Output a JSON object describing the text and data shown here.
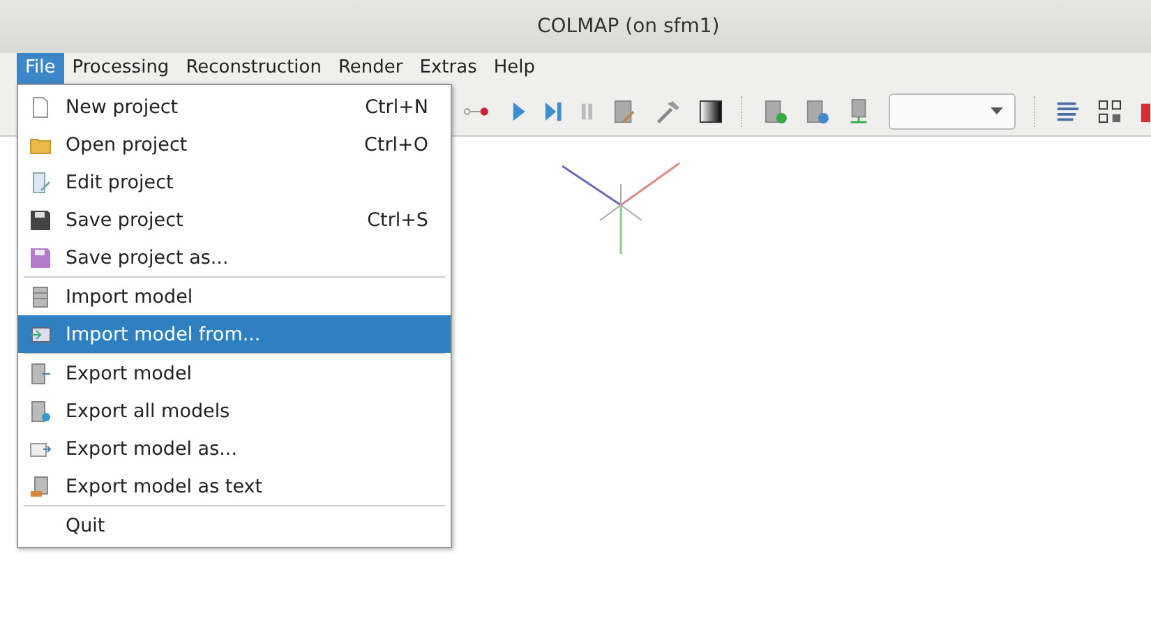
{
  "window": {
    "title": "COLMAP (on sfm1)"
  },
  "menu_bar": [
    {
      "label": "File",
      "selected": true
    },
    {
      "label": "Processing",
      "selected": false
    },
    {
      "label": "Reconstruction",
      "selected": false
    },
    {
      "label": "Render",
      "selected": false
    },
    {
      "label": "Extras",
      "selected": false
    },
    {
      "label": "Help",
      "selected": false
    }
  ],
  "file_menu": [
    {
      "kind": "item",
      "label": "New project",
      "shortcut": "Ctrl+N",
      "selected": false
    },
    {
      "kind": "item",
      "label": "Open project",
      "shortcut": "Ctrl+O",
      "selected": false
    },
    {
      "kind": "item",
      "label": "Edit project",
      "selected": false
    },
    {
      "kind": "item",
      "label": "Save project",
      "shortcut": "Ctrl+S",
      "selected": false
    },
    {
      "kind": "item",
      "label": "Save project as...",
      "selected": false
    },
    {
      "kind": "separator"
    },
    {
      "kind": "item",
      "label": "Import model",
      "selected": false
    },
    {
      "kind": "item",
      "label": "Import model from...",
      "selected": true
    },
    {
      "kind": "separator"
    },
    {
      "kind": "item",
      "label": "Export model",
      "selected": false
    },
    {
      "kind": "item",
      "label": "Export all models",
      "selected": false
    },
    {
      "kind": "item",
      "label": "Export model as...",
      "selected": false
    },
    {
      "kind": "item",
      "label": "Export model as text",
      "selected": false
    },
    {
      "kind": "separator"
    },
    {
      "kind": "item",
      "label": "Quit",
      "selected": false
    }
  ]
}
